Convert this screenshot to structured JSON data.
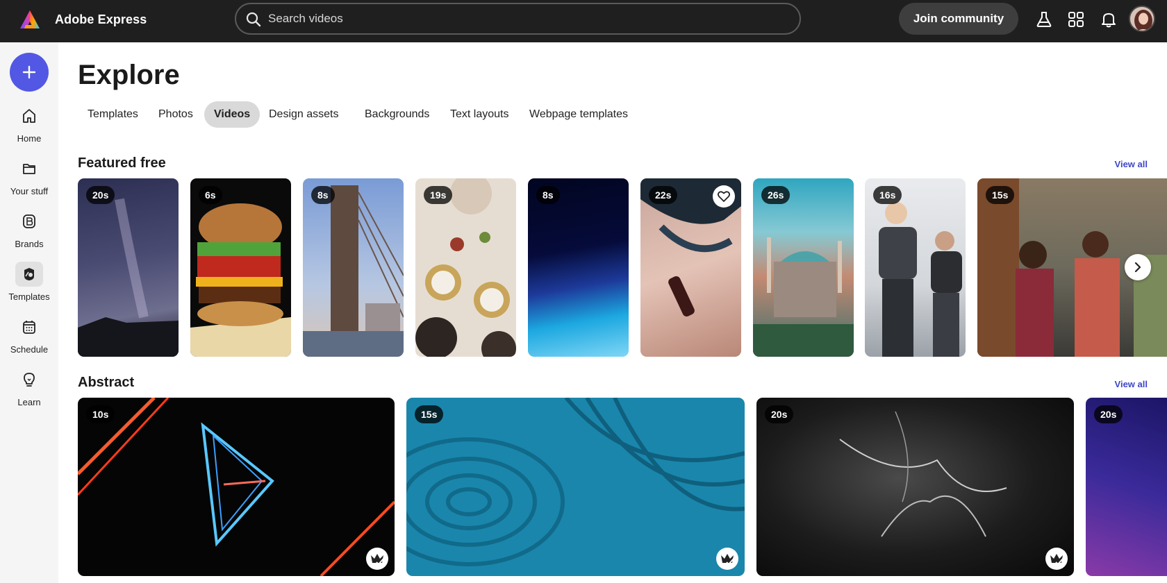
{
  "app": {
    "title": "Adobe Express"
  },
  "search": {
    "placeholder": "Search videos"
  },
  "header": {
    "join_label": "Join community"
  },
  "sidebar": {
    "items": [
      {
        "label": "Home",
        "icon": "home-icon"
      },
      {
        "label": "Your stuff",
        "icon": "folder-icon"
      },
      {
        "label": "Brands",
        "icon": "brand-icon"
      },
      {
        "label": "Templates",
        "icon": "templates-icon"
      },
      {
        "label": "Schedule",
        "icon": "calendar-icon"
      },
      {
        "label": "Learn",
        "icon": "lightbulb-icon"
      }
    ]
  },
  "page": {
    "title": "Explore"
  },
  "tabs": [
    "Templates",
    "Photos",
    "Videos",
    "Design assets",
    "Backgrounds",
    "Text layouts",
    "Webpage templates"
  ],
  "sections": {
    "featured": {
      "title": "Featured free",
      "view_all": "View all",
      "cards": [
        {
          "duration": "20s"
        },
        {
          "duration": "6s"
        },
        {
          "duration": "8s"
        },
        {
          "duration": "19s"
        },
        {
          "duration": "8s"
        },
        {
          "duration": "22s"
        },
        {
          "duration": "26s"
        },
        {
          "duration": "16s"
        },
        {
          "duration": "15s"
        }
      ]
    },
    "abstract": {
      "title": "Abstract",
      "view_all": "View all",
      "cards": [
        {
          "duration": "10s"
        },
        {
          "duration": "15s"
        },
        {
          "duration": "20s"
        },
        {
          "duration": "20s"
        }
      ]
    }
  },
  "colors": {
    "topbar": "#1f1f1f",
    "accent": "#5258e4",
    "link": "#3d47c8"
  }
}
